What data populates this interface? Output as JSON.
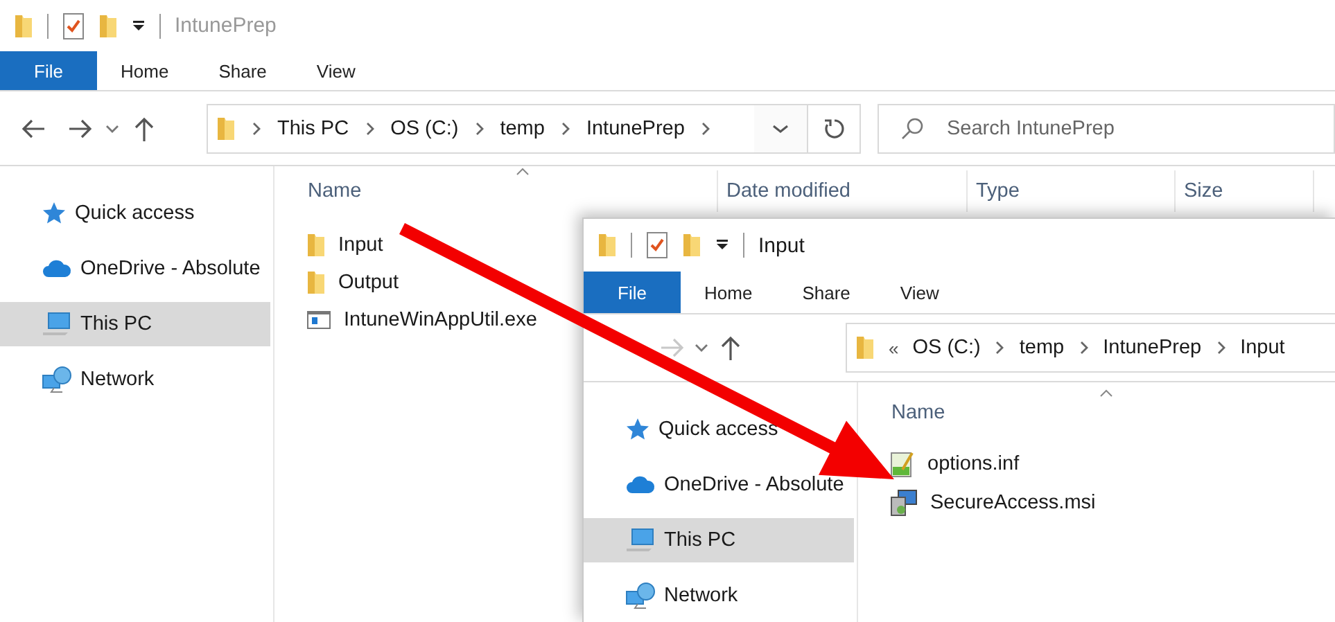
{
  "windows": [
    {
      "title": "IntunePrep",
      "ribbon": {
        "file_label": "File",
        "tabs": [
          "Home",
          "Share",
          "View"
        ]
      },
      "nav": [
        {
          "kind": "back",
          "disabled": false
        },
        {
          "kind": "forward",
          "disabled": false
        },
        {
          "kind": "recent",
          "disabled": false
        },
        {
          "kind": "up",
          "disabled": false
        }
      ],
      "address": {
        "crumbs": [
          "This PC",
          "OS (C:)",
          "temp",
          "IntunePrep"
        ],
        "trailing_chevron": true
      },
      "search": {
        "placeholder": "Search IntunePrep"
      },
      "columns": [
        "Name",
        "Date modified",
        "Type",
        "Size"
      ],
      "sidebar": [
        {
          "label": "Quick access",
          "kind": "star",
          "selected": false
        },
        {
          "label": "OneDrive - Absolute",
          "kind": "cloud",
          "selected": false
        },
        {
          "label": "This PC",
          "kind": "pc",
          "selected": true
        },
        {
          "label": "Network",
          "kind": "network",
          "selected": false
        }
      ],
      "files": [
        {
          "name": "Input",
          "kind": "folder"
        },
        {
          "name": "Output",
          "kind": "folder"
        },
        {
          "name": "IntuneWinAppUtil.exe",
          "kind": "exe"
        }
      ]
    },
    {
      "title": "Input",
      "ribbon": {
        "file_label": "File",
        "tabs": [
          "Home",
          "Share",
          "View"
        ]
      },
      "nav": [
        {
          "kind": "forward",
          "disabled": true
        },
        {
          "kind": "recent",
          "disabled": false
        },
        {
          "kind": "up",
          "disabled": false
        }
      ],
      "address": {
        "overflow": "«",
        "crumbs": [
          "OS (C:)",
          "temp",
          "IntunePrep",
          "Input"
        ],
        "trailing_chevron": false
      },
      "columns": [
        "Name"
      ],
      "sidebar": [
        {
          "label": "Quick access",
          "kind": "star",
          "selected": false
        },
        {
          "label": "OneDrive - Absolute",
          "kind": "cloud",
          "selected": false
        },
        {
          "label": "This PC",
          "kind": "pc",
          "selected": true
        },
        {
          "label": "Network",
          "kind": "network",
          "selected": false
        }
      ],
      "files": [
        {
          "name": "options.inf",
          "kind": "inf"
        },
        {
          "name": "SecureAccess.msi",
          "kind": "msi"
        }
      ]
    }
  ]
}
